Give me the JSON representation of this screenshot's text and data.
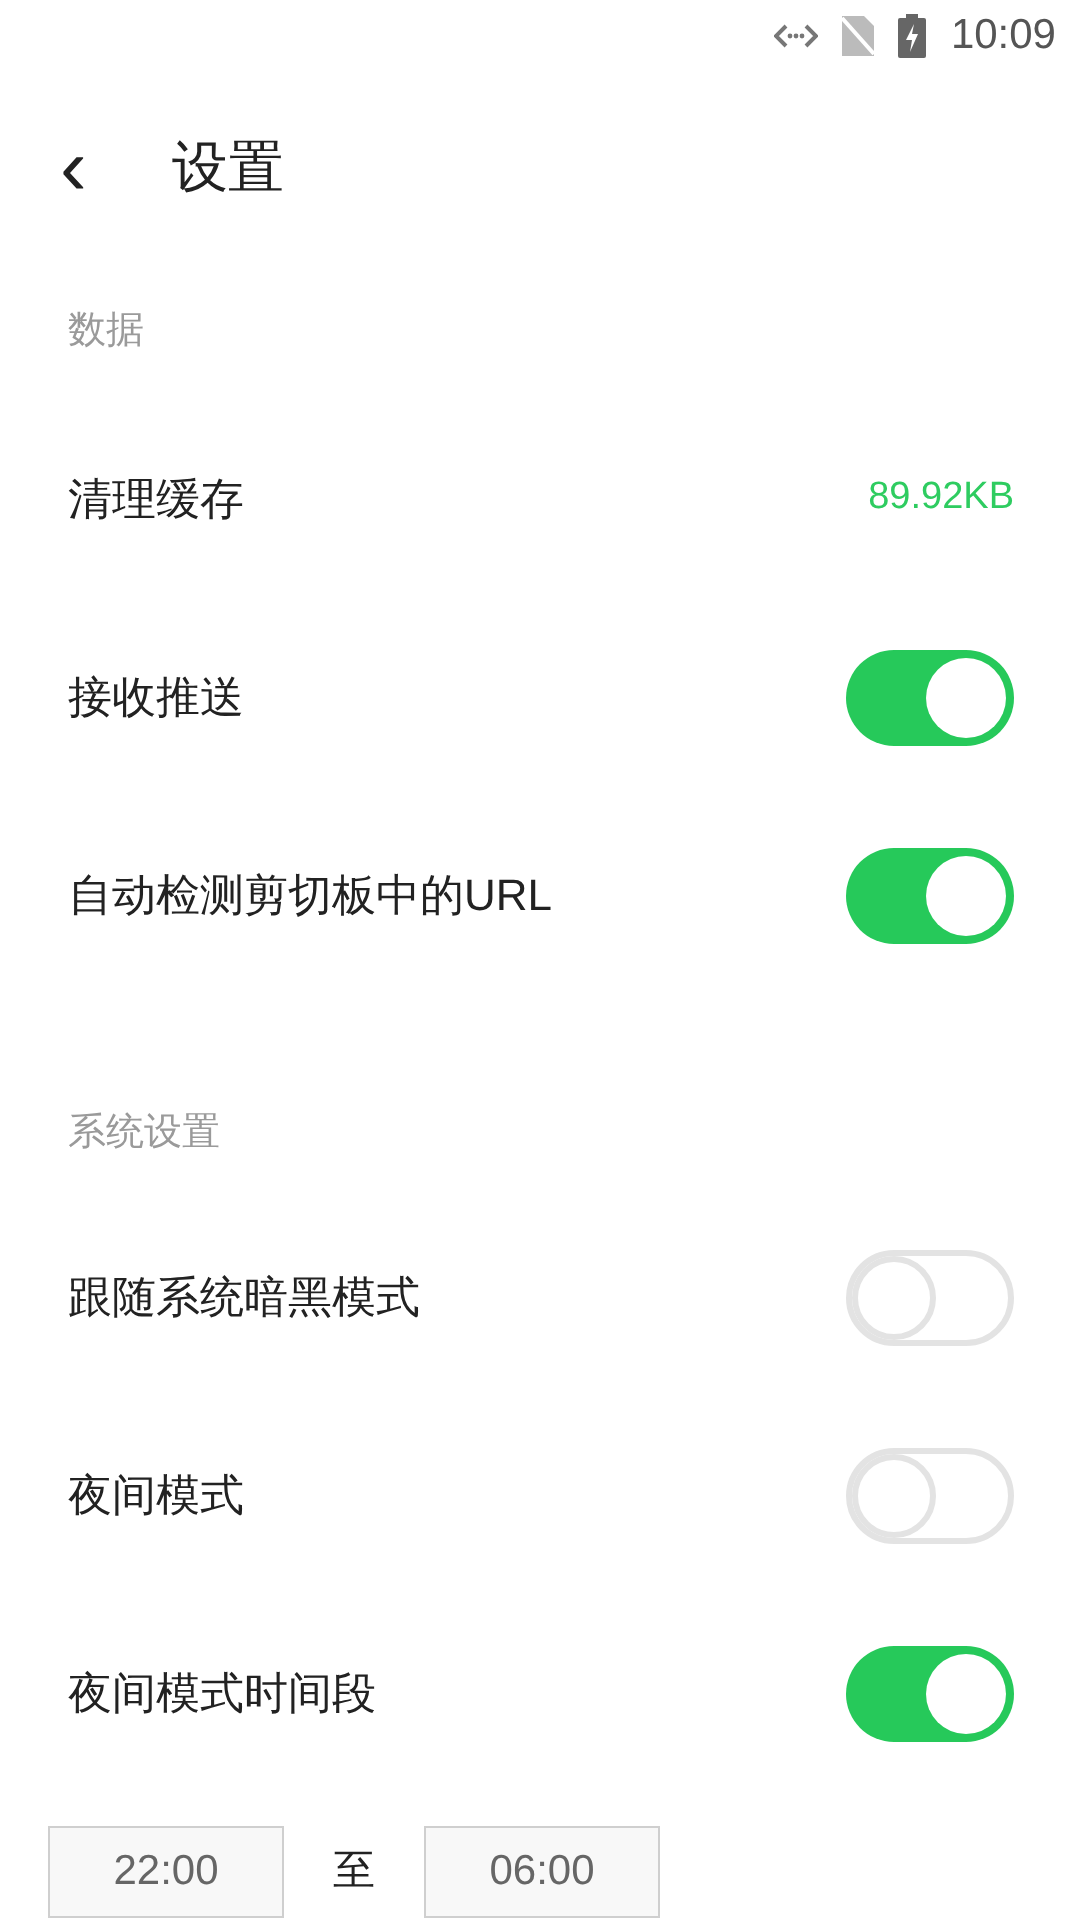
{
  "status_bar": {
    "time": "10:09"
  },
  "header": {
    "back": "‹",
    "title": "设置"
  },
  "sections": [
    {
      "title": "数据",
      "rows": [
        {
          "kind": "value",
          "label": "清理缓存",
          "value": "89.92KB"
        },
        {
          "kind": "toggle",
          "label": "接收推送",
          "on": true
        },
        {
          "kind": "toggle",
          "label": "自动检测剪切板中的URL",
          "on": true
        }
      ]
    },
    {
      "title": "系统设置",
      "rows": [
        {
          "kind": "toggle",
          "label": "跟随系统暗黑模式",
          "on": false
        },
        {
          "kind": "toggle",
          "label": "夜间模式",
          "on": false
        },
        {
          "kind": "toggle",
          "label": "夜间模式时间段",
          "on": true
        }
      ]
    }
  ],
  "time_range": {
    "start": "22:00",
    "separator": "至",
    "end": "06:00"
  }
}
